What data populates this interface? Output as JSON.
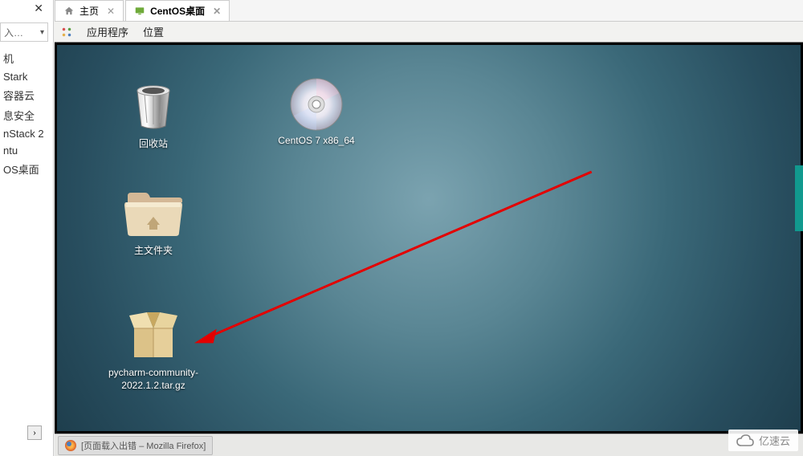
{
  "left_panel": {
    "close_glyph": "✕",
    "search_placeholder": "入…",
    "items": [
      "机",
      "Stark",
      "容器云",
      "息安全",
      "nStack 2",
      "ntu",
      "OS桌面"
    ]
  },
  "tabs": {
    "home": {
      "label": "主页",
      "close": "✕"
    },
    "active": {
      "label": "CentOS桌面",
      "close": "✕"
    }
  },
  "menu": {
    "applications": "应用程序",
    "places": "位置"
  },
  "desktop_icons": {
    "trash": "回收站",
    "disc": "CentOS 7 x86_64",
    "home_folder": "主文件夹",
    "package": "pycharm-community-2022.1.2.tar.gz"
  },
  "taskbar": {
    "firefox": "[页面载入出错 – Mozilla Firefox]"
  },
  "watermark": "亿速云",
  "annotation": {
    "arrow_color": "#e30000"
  }
}
